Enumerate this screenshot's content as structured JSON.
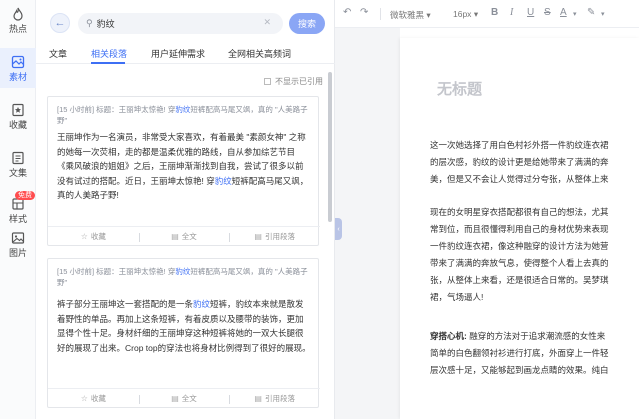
{
  "nav": [
    {
      "label": "热点",
      "icon": "flame-icon"
    },
    {
      "label": "素材",
      "icon": "material-icon"
    },
    {
      "label": "收藏",
      "icon": "star-doc-icon"
    },
    {
      "label": "文集",
      "icon": "collection-icon"
    },
    {
      "label": "样式",
      "icon": "style-icon",
      "badge": "免费"
    },
    {
      "label": "图片",
      "icon": "image-icon"
    }
  ],
  "search": {
    "value": "豹纹",
    "button": "搜索"
  },
  "tabs": [
    "文章",
    "相关段落",
    "用户延伸需求",
    "全网相关高频词"
  ],
  "no_cite": "不显示已引用",
  "cards": [
    {
      "src_pre": "[15 小时前]  标题：王丽坤太惊艳! 穿",
      "src_hl": "豹纹",
      "src_post": "短裤配高马尾又飒，真的 \"人美路子野\"",
      "body_a": "王丽坤作为一名演员，非常受大家喜欢，有着最美 \"素颜女神\" 之称的她每一次荧相，走的都是温柔优雅的路线，自从参加综艺节目《乘风破浪的姐姐》之后，王丽坤渐渐找到自我，尝试了很多以前没有试过的搭配。近日，王丽坤太惊艳! 穿",
      "body_hl": "豹纹",
      "body_b": "短裤配高马尾又飒，真的人美路子野!",
      "actions": [
        "收藏",
        "全文",
        "引用段落"
      ]
    },
    {
      "src_pre": "[15 小时前]  标题：王丽坤太惊艳! 穿",
      "src_hl": "豹纹",
      "src_post": "短裤配高马尾又飒，真的 \"人美路子野\"",
      "body_a": "裤子部分王丽坤这一套搭配的是一条",
      "body_hl": "豹纹",
      "body_b": "短裤，豹纹本来就是散发着野性的单品。再加上这条短裤，有着皮质以及腰带的装饰，更加显得个性十足。身材纤细的王丽坤穿这种短裤将她的一双大长腿很好的展现了出来。Crop top的穿法也将身材比例得到了很好的展现。",
      "actions": [
        "收藏",
        "全文",
        "引用段落"
      ]
    }
  ],
  "toolbar": {
    "style": "微软雅黑",
    "size": "16px",
    "undo": "↶",
    "redo": "↷",
    "bold": "B",
    "italic": "I",
    "underline": "U",
    "strike": "S",
    "color": "A"
  },
  "doc": {
    "title": "无标题",
    "p1": "这一次她选择了用白色村衫外搭一件豹纹连衣裙\n的层次感，豹纹的设计更是给她带来了满满的奔\n美，但是又不会让人觉得过分夸张，从整体上来",
    "p2": "现在的女明星穿衣搭配都很有自己的想法，尤其\n常到位，而且很懂得利用自己的身材优势来表现\n一件豹纹连衣裙，像这种融穿的设计方法为她营\n带来了满满的奔放气息，使得整个人看上去真的\n张，从整体上来看，还是很适合日常的。吴梦琪\n裙，气场逼人!",
    "p3_bold": "穿搭心机:",
    "p3": " 融穿的方法对于追求潮流感的女性来\n简单的白色翻领衬衫进行打底，外面穿上一件轻\n层次感十足，又能够起到画龙点睛的效果。纯白\n"
  }
}
